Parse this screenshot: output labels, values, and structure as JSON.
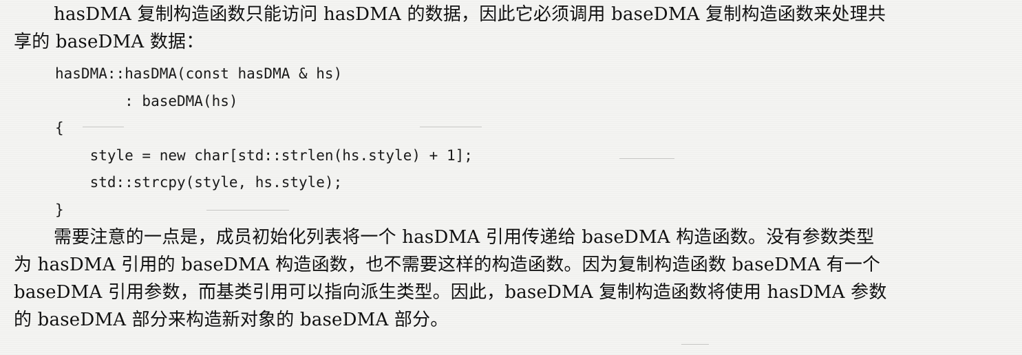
{
  "paragraph1": {
    "lines": [
      "hasDMA 复制构造函数只能访问 hasDMA 的数据，因此它必须调用 baseDMA 复制构造函数来处理共",
      "享的 baseDMA 数据："
    ]
  },
  "code": {
    "lines": [
      "hasDMA::hasDMA(const hasDMA & hs)",
      "        : baseDMA(hs)",
      "{",
      "    style = new char[std::strlen(hs.style) + 1];",
      "    std::strcpy(style, hs.style);",
      "}"
    ]
  },
  "paragraph2": {
    "lines": [
      "需要注意的一点是，成员初始化列表将一个 hasDMA 引用传递给 baseDMA 构造函数。没有参数类型",
      "为 hasDMA 引用的 baseDMA 构造函数，也不需要这样的构造函数。因为复制构造函数 baseDMA 有一个",
      "baseDMA 引用参数，而基类引用可以指向派生类型。因此，baseDMA 复制构造函数将使用 hasDMA 参数",
      "的 baseDMA 部分来构造新对象的 baseDMA 部分。"
    ]
  }
}
